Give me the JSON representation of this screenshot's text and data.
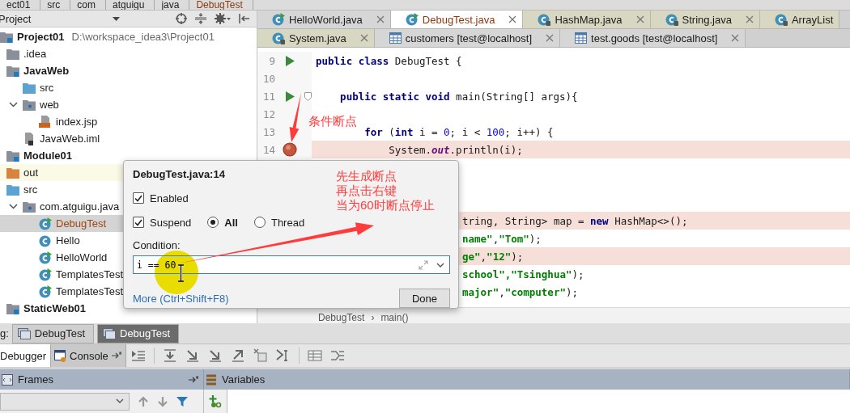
{
  "breadcrumbs": [
    "ect01",
    "src",
    "com",
    "atguigu",
    "java",
    "DebugTest"
  ],
  "project_panel": {
    "view": "Project",
    "tree": [
      {
        "label": "Project01",
        "path": "D:\\workspace_idea3\\Project01",
        "kind": "module",
        "selected": false,
        "highlighted": false,
        "children": [
          {
            "label": ".idea",
            "kind": "folder",
            "selected": false,
            "highlighted": false
          },
          {
            "label": "JavaWeb",
            "kind": "module",
            "selected": false,
            "highlighted": false,
            "children": [
              {
                "label": "src",
                "kind": "source",
                "selected": false,
                "highlighted": false
              },
              {
                "label": "web",
                "kind": "web",
                "expanded": true,
                "selected": false,
                "highlighted": false,
                "children": [
                  {
                    "label": "index.jsp",
                    "kind": "jsp",
                    "selected": false,
                    "highlighted": false
                  }
                ]
              },
              {
                "label": "JavaWeb.iml",
                "kind": "iml",
                "selected": false,
                "highlighted": false
              }
            ]
          },
          {
            "label": "Module01",
            "kind": "module",
            "selected": false,
            "highlighted": false
          },
          {
            "label": "out",
            "kind": "output",
            "selected": false,
            "highlighted": true
          },
          {
            "label": "src",
            "kind": "source",
            "selected": false,
            "highlighted": false,
            "children": [
              {
                "label": "com.atguigu.java",
                "kind": "package",
                "expanded": true,
                "selected": false,
                "highlighted": false,
                "children": [
                  {
                    "label": "DebugTest",
                    "kind": "class-run",
                    "selected": true,
                    "highlighted": false
                  },
                  {
                    "label": "Hello",
                    "kind": "class",
                    "selected": false,
                    "highlighted": false
                  },
                  {
                    "label": "HelloWorld",
                    "kind": "class-run",
                    "selected": false,
                    "highlighted": false
                  },
                  {
                    "label": "TemplatesTest",
                    "kind": "class-run",
                    "selected": false,
                    "highlighted": false
                  },
                  {
                    "label": "TemplatesTest",
                    "kind": "class-run",
                    "selected": false,
                    "highlighted": false
                  }
                ]
              }
            ]
          },
          {
            "label": "StaticWeb01",
            "kind": "module",
            "selected": false,
            "highlighted": false
          }
        ]
      }
    ]
  },
  "editor": {
    "tabs": [
      [
        {
          "label": "HelloWorld.java",
          "kind": "class",
          "selected": false,
          "close_button": true
        },
        {
          "label": "DebugTest.java",
          "kind": "class",
          "selected": true,
          "close_button": true
        },
        {
          "label": "HashMap.java",
          "kind": "library",
          "selected": false,
          "close_button": true
        },
        {
          "label": "String.java",
          "kind": "library",
          "selected": false,
          "close_button": true
        },
        {
          "label": "ArrayList",
          "kind": "library",
          "selected": false,
          "close_button": false
        }
      ],
      [
        {
          "label": "System.java",
          "kind": "library",
          "selected": false,
          "close_button": true
        },
        {
          "label": "customers [test@localhost]",
          "kind": "table",
          "selected": false,
          "close_button": true
        },
        {
          "label": "test.goods [test@localhost]",
          "kind": "table",
          "selected": false,
          "close_button": true
        }
      ]
    ],
    "lines": [
      {
        "kind": "line",
        "number": "9",
        "run_button": true,
        "breakpoint": false,
        "fold": false,
        "highlighted": false,
        "segments": [
          {
            "kind": "keyword",
            "text": "public class"
          },
          {
            "kind": "plain",
            "text": " DebugTest {"
          }
        ]
      },
      {
        "kind": "line",
        "number": "10",
        "run_button": false,
        "breakpoint": false,
        "fold": false,
        "highlighted": false
      },
      {
        "kind": "line",
        "number": "11",
        "run_button": true,
        "breakpoint": false,
        "fold": true,
        "highlighted": false,
        "segments": [
          {
            "kind": "keyword",
            "text": "    public static void"
          },
          {
            "kind": "plain",
            "text": " main(String[] args){"
          }
        ]
      },
      {
        "kind": "line",
        "number": "12",
        "run_button": false,
        "breakpoint": false,
        "fold": false,
        "highlighted": false
      },
      {
        "kind": "line",
        "number": "13",
        "run_button": false,
        "breakpoint": false,
        "fold": false,
        "highlighted": false,
        "segments": [
          {
            "kind": "keyword",
            "text": "        for"
          },
          {
            "kind": "plain",
            "text": " ("
          },
          {
            "kind": "keyword",
            "text": "int"
          },
          {
            "kind": "plain",
            "text": " i = "
          },
          {
            "kind": "number",
            "text": "0"
          },
          {
            "kind": "plain",
            "text": "; i < "
          },
          {
            "kind": "number",
            "text": "100"
          },
          {
            "kind": "plain",
            "text": "; i++) {"
          }
        ]
      },
      {
        "kind": "line",
        "number": "14",
        "run_button": false,
        "breakpoint": true,
        "fold": false,
        "highlighted": true,
        "segments": [
          {
            "kind": "plain",
            "text": "            System."
          },
          {
            "kind": "field",
            "text": "out"
          },
          {
            "kind": "plain",
            "text": ".println(i);"
          }
        ]
      },
      {
        "kind": "covered",
        "highlighted": false
      },
      {
        "kind": "covered",
        "highlighted": false
      },
      {
        "kind": "covered",
        "highlighted": false
      },
      {
        "kind": "covered",
        "highlighted": true,
        "segments": [
          {
            "kind": "plain",
            "text": "tring, String> map = "
          },
          {
            "kind": "keyword",
            "text": "new"
          },
          {
            "kind": "plain",
            "text": " HashMap<>();"
          }
        ]
      },
      {
        "kind": "covered",
        "highlighted": false,
        "segments": [
          {
            "kind": "string",
            "text": "name\""
          },
          {
            "kind": "plain",
            "text": ","
          },
          {
            "kind": "string",
            "text": "\"Tom\""
          },
          {
            "kind": "plain",
            "text": ");"
          }
        ]
      },
      {
        "kind": "covered",
        "highlighted": true,
        "segments": [
          {
            "kind": "string",
            "text": "ge\""
          },
          {
            "kind": "plain",
            "text": ","
          },
          {
            "kind": "string",
            "text": "\"12\""
          },
          {
            "kind": "plain",
            "text": ");"
          }
        ]
      },
      {
        "kind": "covered",
        "highlighted": false,
        "segments": [
          {
            "kind": "string",
            "text": "school\","
          },
          {
            "kind": "string",
            "text": "\"Tsinghua\""
          },
          {
            "kind": "plain",
            "text": ");"
          }
        ]
      },
      {
        "kind": "covered",
        "highlighted": false,
        "segments": [
          {
            "kind": "string",
            "text": "major\""
          },
          {
            "kind": "plain",
            "text": ","
          },
          {
            "kind": "string",
            "text": "\"computer\""
          },
          {
            "kind": "plain",
            "text": ");"
          }
        ]
      }
    ],
    "breadcrumb": {
      "items": [
        "DebugTest",
        "main()"
      ],
      "separator": "›"
    }
  },
  "breakpoint_popup": {
    "title": "DebugTest.java:14",
    "rows": [
      [
        {
          "kind": "checkbox",
          "label": "Enabled",
          "checked": true
        }
      ],
      [
        {
          "kind": "checkbox",
          "label": "Suspend",
          "checked": true
        },
        {
          "kind": "radio",
          "label": "All",
          "selected": true
        },
        {
          "kind": "radio",
          "label": "Thread",
          "selected": false
        }
      ]
    ],
    "condition": {
      "label": "Condition:",
      "value": "i == 60"
    },
    "link": "More (Ctrl+Shift+F8)",
    "button": "Done"
  },
  "annotations": {
    "label": "条件断点",
    "note": [
      "先生成断点",
      "再点击右键",
      "当为60时断点停止"
    ]
  },
  "debug": {
    "label": "g:",
    "sessions": [
      {
        "label": "DebugTest",
        "selected": false
      },
      {
        "label": "DebugTest",
        "selected": true
      }
    ],
    "tabs": [
      {
        "label": "Debugger",
        "selected": true
      },
      {
        "label": "Console",
        "selected": false
      }
    ],
    "frames": {
      "title": "Frames"
    },
    "variables": {
      "title": "Variables"
    }
  }
}
